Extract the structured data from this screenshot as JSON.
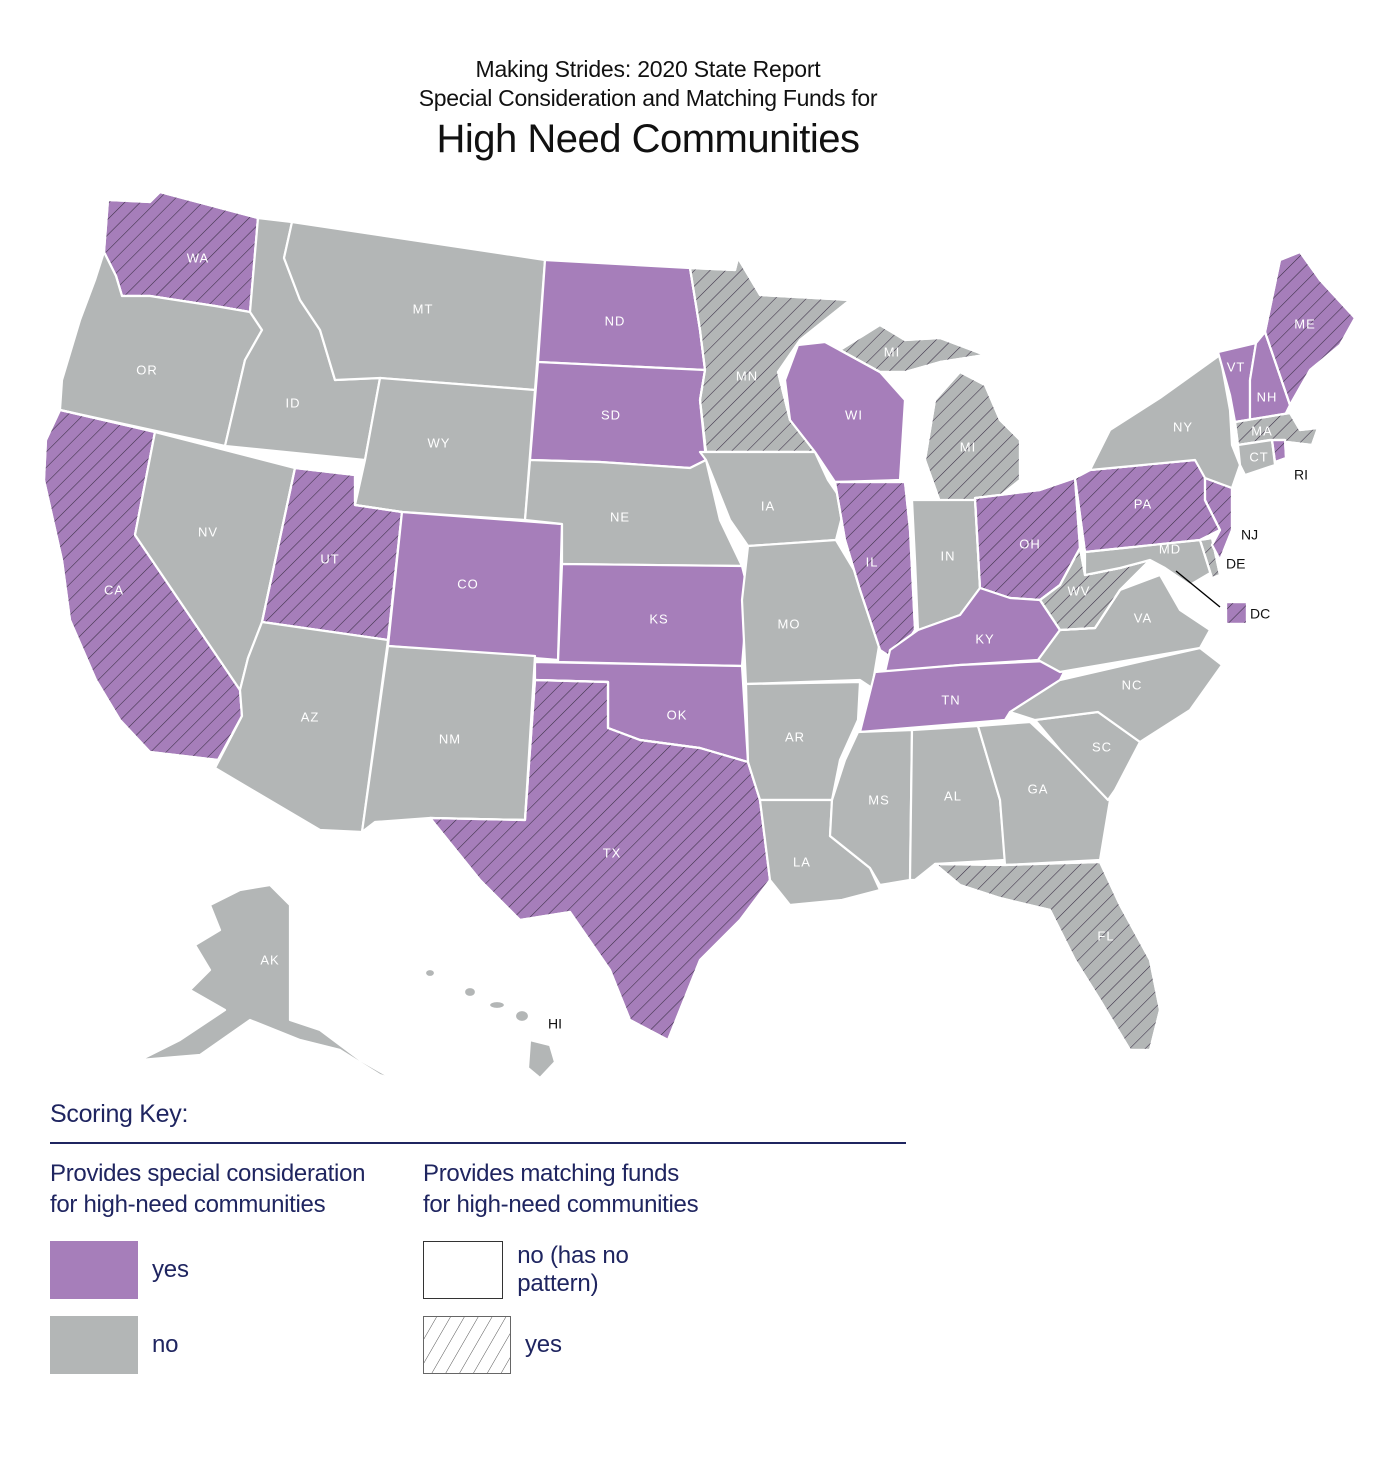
{
  "title": {
    "line1": "Making Strides:  2020 State Report",
    "line2": "Special Consideration and Matching Funds for",
    "line3": "High Need Communities"
  },
  "colors": {
    "special_consideration_yes": "#A67EBA",
    "special_consideration_no": "#B3B6B6",
    "hatch_line": "#3a2f45",
    "border": "#ffffff",
    "key_text": "#1f2560"
  },
  "states": [
    {
      "abbr": "WA",
      "special_consideration": "yes",
      "matching_funds": "yes"
    },
    {
      "abbr": "OR",
      "special_consideration": "no",
      "matching_funds": "no"
    },
    {
      "abbr": "CA",
      "special_consideration": "yes",
      "matching_funds": "yes"
    },
    {
      "abbr": "ID",
      "special_consideration": "no",
      "matching_funds": "no"
    },
    {
      "abbr": "NV",
      "special_consideration": "no",
      "matching_funds": "no"
    },
    {
      "abbr": "MT",
      "special_consideration": "no",
      "matching_funds": "no"
    },
    {
      "abbr": "WY",
      "special_consideration": "no",
      "matching_funds": "no"
    },
    {
      "abbr": "UT",
      "special_consideration": "yes",
      "matching_funds": "yes"
    },
    {
      "abbr": "AZ",
      "special_consideration": "no",
      "matching_funds": "no"
    },
    {
      "abbr": "CO",
      "special_consideration": "yes",
      "matching_funds": "no"
    },
    {
      "abbr": "NM",
      "special_consideration": "no",
      "matching_funds": "no"
    },
    {
      "abbr": "ND",
      "special_consideration": "yes",
      "matching_funds": "no"
    },
    {
      "abbr": "SD",
      "special_consideration": "yes",
      "matching_funds": "no"
    },
    {
      "abbr": "NE",
      "special_consideration": "no",
      "matching_funds": "no"
    },
    {
      "abbr": "KS",
      "special_consideration": "yes",
      "matching_funds": "no"
    },
    {
      "abbr": "OK",
      "special_consideration": "yes",
      "matching_funds": "no"
    },
    {
      "abbr": "TX",
      "special_consideration": "yes",
      "matching_funds": "yes"
    },
    {
      "abbr": "MN",
      "special_consideration": "no",
      "matching_funds": "yes"
    },
    {
      "abbr": "IA",
      "special_consideration": "no",
      "matching_funds": "no"
    },
    {
      "abbr": "MO",
      "special_consideration": "no",
      "matching_funds": "no"
    },
    {
      "abbr": "AR",
      "special_consideration": "no",
      "matching_funds": "no"
    },
    {
      "abbr": "LA",
      "special_consideration": "no",
      "matching_funds": "no"
    },
    {
      "abbr": "WI",
      "special_consideration": "yes",
      "matching_funds": "no"
    },
    {
      "abbr": "IL",
      "special_consideration": "yes",
      "matching_funds": "yes"
    },
    {
      "abbr": "MI",
      "special_consideration": "no",
      "matching_funds": "yes"
    },
    {
      "abbr": "IN",
      "special_consideration": "no",
      "matching_funds": "no"
    },
    {
      "abbr": "OH",
      "special_consideration": "yes",
      "matching_funds": "yes"
    },
    {
      "abbr": "KY",
      "special_consideration": "yes",
      "matching_funds": "no"
    },
    {
      "abbr": "TN",
      "special_consideration": "yes",
      "matching_funds": "no"
    },
    {
      "abbr": "MS",
      "special_consideration": "no",
      "matching_funds": "no"
    },
    {
      "abbr": "AL",
      "special_consideration": "no",
      "matching_funds": "no"
    },
    {
      "abbr": "GA",
      "special_consideration": "no",
      "matching_funds": "no"
    },
    {
      "abbr": "FL",
      "special_consideration": "no",
      "matching_funds": "yes"
    },
    {
      "abbr": "SC",
      "special_consideration": "no",
      "matching_funds": "no"
    },
    {
      "abbr": "NC",
      "special_consideration": "no",
      "matching_funds": "no"
    },
    {
      "abbr": "VA",
      "special_consideration": "no",
      "matching_funds": "no"
    },
    {
      "abbr": "WV",
      "special_consideration": "no",
      "matching_funds": "yes"
    },
    {
      "abbr": "MD",
      "special_consideration": "no",
      "matching_funds": "no"
    },
    {
      "abbr": "DE",
      "special_consideration": "no",
      "matching_funds": "yes"
    },
    {
      "abbr": "PA",
      "special_consideration": "yes",
      "matching_funds": "yes"
    },
    {
      "abbr": "NJ",
      "special_consideration": "yes",
      "matching_funds": "yes"
    },
    {
      "abbr": "NY",
      "special_consideration": "no",
      "matching_funds": "no"
    },
    {
      "abbr": "CT",
      "special_consideration": "no",
      "matching_funds": "no"
    },
    {
      "abbr": "RI",
      "special_consideration": "yes",
      "matching_funds": "yes"
    },
    {
      "abbr": "MA",
      "special_consideration": "no",
      "matching_funds": "yes"
    },
    {
      "abbr": "VT",
      "special_consideration": "yes",
      "matching_funds": "no"
    },
    {
      "abbr": "NH",
      "special_consideration": "yes",
      "matching_funds": "no"
    },
    {
      "abbr": "ME",
      "special_consideration": "yes",
      "matching_funds": "yes"
    },
    {
      "abbr": "DC",
      "special_consideration": "yes",
      "matching_funds": "yes"
    },
    {
      "abbr": "AK",
      "special_consideration": "no",
      "matching_funds": "no"
    },
    {
      "abbr": "HI",
      "special_consideration": "no",
      "matching_funds": "no"
    }
  ],
  "labels": {
    "WA": "WA",
    "OR": "OR",
    "CA": "CA",
    "ID": "ID",
    "NV": "NV",
    "MT": "MT",
    "WY": "WY",
    "UT": "UT",
    "AZ": "AZ",
    "CO": "CO",
    "NM": "NM",
    "ND": "ND",
    "SD": "SD",
    "NE": "NE",
    "KS": "KS",
    "OK": "OK",
    "TX": "TX",
    "MN": "MN",
    "IA": "IA",
    "MO": "MO",
    "AR": "AR",
    "LA": "LA",
    "WI": "WI",
    "IL": "IL",
    "MI_UP": "MI",
    "MI": "MI",
    "IN": "IN",
    "OH": "OH",
    "KY": "KY",
    "TN": "TN",
    "MS": "MS",
    "AL": "AL",
    "GA": "GA",
    "FL": "FL",
    "SC": "SC",
    "NC": "NC",
    "VA": "VA",
    "WV": "WV",
    "MD": "MD",
    "PA": "PA",
    "NY": "NY",
    "CT": "CT",
    "MA": "MA",
    "VT": "VT",
    "NH": "NH",
    "ME": "ME",
    "AK": "AK"
  },
  "external_labels": {
    "RI": "RI",
    "NJ": "NJ",
    "DE": "DE",
    "DC": "DC",
    "HI": "HI"
  },
  "key": {
    "title": "Scoring Key:",
    "col1": {
      "heading_line1": "Provides special consideration",
      "heading_line2": "for high-need communities",
      "items": [
        {
          "label": "yes",
          "value": "yes"
        },
        {
          "label": "no",
          "value": "no"
        }
      ]
    },
    "col2": {
      "heading_line1": "Provides matching funds",
      "heading_line2": "for high-need communities",
      "items": [
        {
          "label": "no (has no pattern)",
          "value": "no"
        },
        {
          "label": "yes",
          "value": "yes"
        }
      ]
    }
  }
}
